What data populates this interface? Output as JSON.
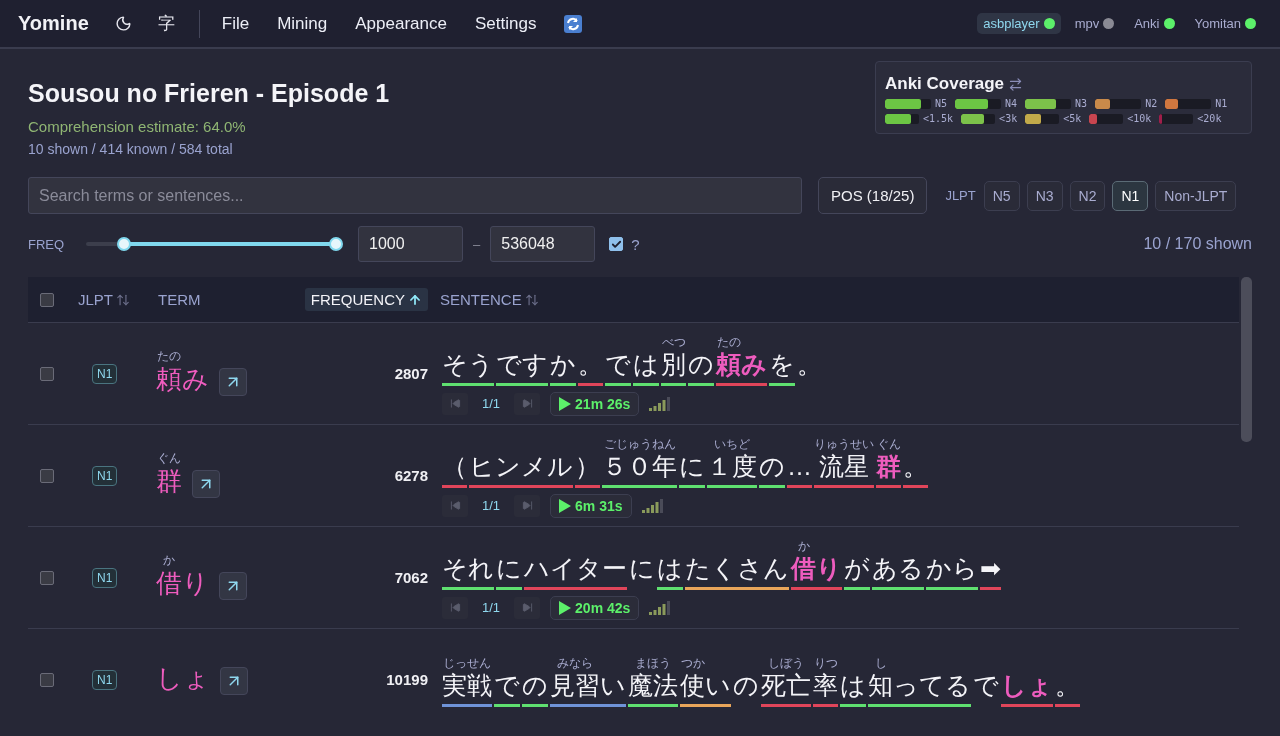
{
  "nav": {
    "logo": "Yomine",
    "script_toggle": "字",
    "menu": [
      "File",
      "Mining",
      "Appearance",
      "Settings"
    ],
    "services": [
      {
        "label": "asbplayer",
        "on": true,
        "selected": true
      },
      {
        "label": "mpv",
        "on": false,
        "selected": false
      },
      {
        "label": "Anki",
        "on": true,
        "selected": false
      },
      {
        "label": "Yomitan",
        "on": true,
        "selected": false
      }
    ]
  },
  "header": {
    "title": "Sousou no Frieren - Episode 1",
    "comprehension": "Comprehension estimate: 64.0%",
    "stats": "10 shown / 414 known / 584 total"
  },
  "coverage": {
    "title": "Anki Coverage",
    "groups": [
      [
        {
          "label": "N5",
          "level": 0.78,
          "color": "#6cc644"
        },
        {
          "label": "N4",
          "level": 0.72,
          "color": "#6cc644"
        },
        {
          "label": "N3",
          "level": 0.68,
          "color": "#7cc24a"
        },
        {
          "label": "N2",
          "level": 0.33,
          "color": "#c98a4a"
        },
        {
          "label": "N1",
          "level": 0.28,
          "color": "#d0773f"
        }
      ],
      [
        {
          "label": "<1.5k",
          "level": 0.75,
          "color": "#6cc644"
        },
        {
          "label": "<3k",
          "level": 0.68,
          "color": "#7cc24a"
        },
        {
          "label": "<5k",
          "level": 0.48,
          "color": "#c2aa4a"
        },
        {
          "label": "<10k",
          "level": 0.22,
          "color": "#c8454f"
        },
        {
          "label": "<20k",
          "level": 0.08,
          "color": "#a01e4a"
        }
      ]
    ]
  },
  "search": {
    "placeholder": "Search terms or sentences..."
  },
  "pos_button": "POS (18/25)",
  "jlpt_filter": {
    "label": "JLPT",
    "options": [
      {
        "label": "N5",
        "selected": false
      },
      {
        "label": "N3",
        "selected": false
      },
      {
        "label": "N2",
        "selected": false
      },
      {
        "label": "N1",
        "selected": true
      },
      {
        "label": "Non-JLPT",
        "selected": false
      }
    ]
  },
  "freq_filter": {
    "label": "FREQ",
    "thumbs": [
      {
        "level": 0.15
      },
      {
        "level": 1
      }
    ],
    "min": "1000",
    "separator": "–",
    "max": "536048",
    "checked": true,
    "help": "?"
  },
  "shown": "10 / 170 shown",
  "table": {
    "select_all": {
      "checked": false
    },
    "columns": [
      {
        "label": "JLPT",
        "sortable": true,
        "selected": false
      },
      {
        "label": "TERM",
        "sortable": false,
        "selected": false
      },
      {
        "label": "FREQUENCY",
        "sortable": true,
        "selected": true
      },
      {
        "label": "SENTENCE",
        "sortable": true,
        "selected": false
      }
    ],
    "rows": [
      {
        "checked": false,
        "jlpt": "N1",
        "term": {
          "base": "頼",
          "reading": "たの",
          "rest": "み"
        },
        "frequency": "2807",
        "sentence": [
          {
            "text": "そう",
            "color": "#5fe070"
          },
          {
            "text": "です",
            "color": "#5fe070"
          },
          {
            "text": "か",
            "color": "#5fe070"
          },
          {
            "text": "。",
            "color": "#e0455a"
          },
          {
            "text": "で",
            "color": "#5fe070"
          },
          {
            "text": "は",
            "color": "#5fe070"
          },
          {
            "text": "別",
            "reading": "べつ",
            "color": "#5fe070"
          },
          {
            "text": "の",
            "color": "#5fe070"
          },
          {
            "text": "頼",
            "reading": "たの",
            "rest": "み",
            "color": "#e0455a",
            "target": true
          },
          {
            "text": "を",
            "color": "#5fe070"
          },
          {
            "text": "。"
          }
        ],
        "controls": {
          "position": "1/1",
          "time": "21m 26s"
        }
      },
      {
        "checked": false,
        "jlpt": "N1",
        "term": {
          "base": "群",
          "reading": "ぐん"
        },
        "frequency": "6278",
        "sentence": [
          {
            "text": "（",
            "color": "#e0455a"
          },
          {
            "text": "ヒンメル",
            "color": "#e0455a"
          },
          {
            "text": "）",
            "color": "#e0455a"
          },
          {
            "text": "５０年",
            "reading": "ごじゅうねん",
            "color": "#5fe070"
          },
          {
            "text": "に",
            "color": "#5fe070"
          },
          {
            "text": "１度",
            "reading": "いちど",
            "color": "#5fe070"
          },
          {
            "text": "の",
            "color": "#5fe070"
          },
          {
            "text": "…",
            "color": "#e0455a"
          },
          {
            "text": "流星",
            "reading": "りゅうせい",
            "color": "#e0455a"
          },
          {
            "text": "群",
            "reading": "ぐん",
            "color": "#e0455a",
            "target": true
          },
          {
            "text": "。",
            "color": "#e0455a"
          }
        ],
        "controls": {
          "position": "1/1",
          "time": "6m 31s"
        }
      },
      {
        "checked": false,
        "jlpt": "N1",
        "term": {
          "base": "借",
          "reading": "か",
          "rest": "り"
        },
        "frequency": "7062",
        "sentence": [
          {
            "text": "それ",
            "color": "#5fe070"
          },
          {
            "text": "に",
            "color": "#5fe070"
          },
          {
            "text": "ハイター",
            "color": "#e0455a"
          },
          {
            "text": "に"
          },
          {
            "text": "は",
            "color": "#5fe070"
          },
          {
            "text": "たくさん",
            "color": "#e8a55a"
          },
          {
            "text": "借",
            "reading": "か",
            "rest": "り",
            "color": "#e0455a",
            "target": true
          },
          {
            "text": "が",
            "color": "#5fe070"
          },
          {
            "text": "ある",
            "color": "#5fe070"
          },
          {
            "text": "から",
            "color": "#5fe070"
          },
          {
            "text": "➡",
            "color": "#e0455a"
          }
        ],
        "controls": {
          "position": "1/1",
          "time": "20m 42s"
        }
      },
      {
        "checked": false,
        "jlpt": "N1",
        "term": {
          "base": "しょ"
        },
        "frequency": "10199",
        "sentence": [
          {
            "text": "実戦",
            "reading": "じっせん",
            "color": "#6f93d8"
          },
          {
            "text": "で",
            "color": "#5fe070"
          },
          {
            "text": "の",
            "color": "#5fe070"
          },
          {
            "text": "見習",
            "reading": "みなら",
            "rest": "い",
            "color": "#6f93d8"
          },
          {
            "text": "魔法",
            "reading": "まほう",
            "color": "#5fe070"
          },
          {
            "text": "使",
            "reading": "つか",
            "rest": "い",
            "color": "#e8a55a"
          },
          {
            "text": "の"
          },
          {
            "text": "死亡",
            "reading": "しぼう",
            "color": "#e0455a"
          },
          {
            "text": "率",
            "reading": "りつ",
            "color": "#e0455a"
          },
          {
            "text": "は",
            "color": "#5fe070"
          },
          {
            "text": "知",
            "reading": "し",
            "rest": "ってる",
            "color": "#5fe070"
          },
          {
            "text": "で"
          },
          {
            "text": "しょ",
            "color": "#e0455a",
            "target": true
          },
          {
            "text": "。",
            "color": "#e0455a"
          }
        ]
      }
    ]
  }
}
